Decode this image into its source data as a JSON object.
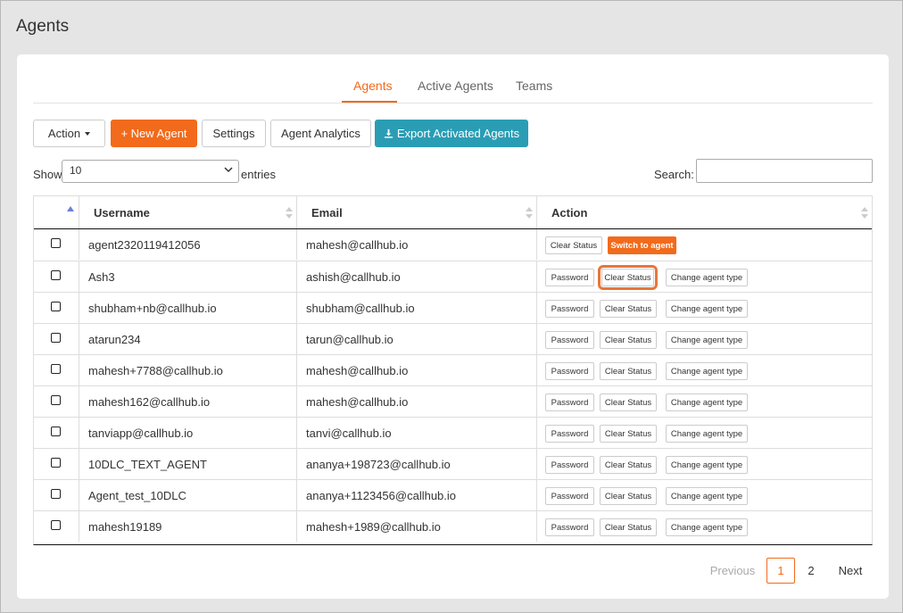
{
  "page": {
    "title": "Agents"
  },
  "tabs": [
    {
      "label": "Agents",
      "active": true
    },
    {
      "label": "Active Agents",
      "active": false
    },
    {
      "label": "Teams",
      "active": false
    }
  ],
  "toolbar": {
    "action_label": "Action",
    "new_agent_label": "+ New Agent",
    "settings_label": "Settings",
    "analytics_label": "Agent Analytics",
    "export_label": "Export Activated Agents"
  },
  "table_controls": {
    "show_label": "Show",
    "page_size": "10",
    "entries_label": "entries",
    "search_label": "Search:",
    "search_value": ""
  },
  "columns": [
    "Username",
    "Email",
    "Action"
  ],
  "rows": [
    {
      "username": "agent2320119412056",
      "email": "mahesh@callhub.io"
    },
    {
      "username": "Ash3",
      "email": "ashish@callhub.io"
    },
    {
      "username": "shubham+nb@callhub.io",
      "email": "shubham@callhub.io"
    },
    {
      "username": "atarun234",
      "email": "tarun@callhub.io"
    },
    {
      "username": "mahesh+7788@callhub.io",
      "email": "mahesh@callhub.io"
    },
    {
      "username": "mahesh162@callhub.io",
      "email": "mahesh@callhub.io"
    },
    {
      "username": "tanviapp@callhub.io",
      "email": "tanvi@callhub.io"
    },
    {
      "username": "10DLC_TEXT_AGENT",
      "email": "ananya+198723@callhub.io"
    },
    {
      "username": "Agent_test_10DLC",
      "email": "ananya+1123456@callhub.io"
    },
    {
      "username": "mahesh19189",
      "email": "mahesh+1989@callhub.io"
    }
  ],
  "row_actions": {
    "password": "Password",
    "clear_status": "Clear Status",
    "change_type": "Change agent type",
    "switch_to_agent": "Switch to agent"
  },
  "pagination": {
    "previous": "Previous",
    "pages": [
      "1",
      "2"
    ],
    "current": "1",
    "next": "Next"
  },
  "colors": {
    "accent": "#f26a1b",
    "teal": "#2a9db5"
  },
  "icons": {
    "download": "download-icon",
    "sort": "sort-icon",
    "caret": "caret-down-icon"
  }
}
